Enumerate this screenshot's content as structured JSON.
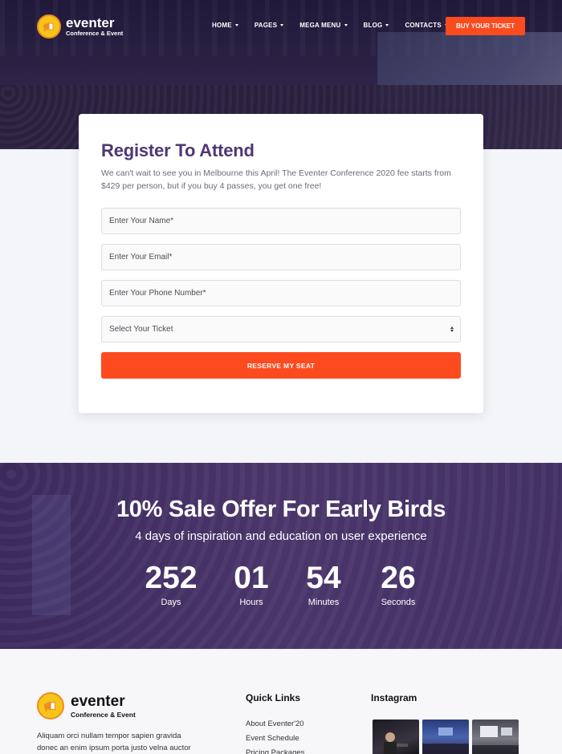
{
  "brand": {
    "name": "eventer",
    "tagline": "Conference & Event"
  },
  "nav": {
    "items": [
      {
        "label": "HOME"
      },
      {
        "label": "PAGES"
      },
      {
        "label": "MEGA MENU"
      },
      {
        "label": "BLOG"
      },
      {
        "label": "CONTACTS"
      }
    ],
    "cta": "BUY YOUR TICKET"
  },
  "register": {
    "title": "Register To Attend",
    "lead": "We can't wait to see you in Melbourne this April! The Eventer Conference 2020 fee starts from $429 per person, but if you buy 4 passes, you get one free!",
    "name_placeholder": "Enter Your Name*",
    "email_placeholder": "Enter Your Email*",
    "phone_placeholder": "Enter Your Phone Number*",
    "ticket_select": "Select Your Ticket",
    "submit": "RESERVE MY SEAT"
  },
  "promo": {
    "title": "10% Sale Offer For Early Birds",
    "subtitle": "4 days of inspiration and education on user experience",
    "countdown": [
      {
        "value": "252",
        "label": "Days"
      },
      {
        "value": "01",
        "label": "Hours"
      },
      {
        "value": "54",
        "label": "Minutes"
      },
      {
        "value": "26",
        "label": "Seconds"
      }
    ]
  },
  "footer": {
    "brand_name": "eventer",
    "brand_tagline": "Conference & Event",
    "about": "Aliquam orci nullam tempor sapien gravida donec an enim ipsum porta justo velna auctor",
    "quick_links_title": "Quick Links",
    "quick_links": [
      "About Eventer'20",
      "Event Schedule",
      "Pricing Packages"
    ],
    "instagram_title": "Instagram"
  },
  "colors": {
    "accent": "#fc4b1f",
    "brand_purple": "#4e3775",
    "logo_yellow": "#f5c51c"
  }
}
